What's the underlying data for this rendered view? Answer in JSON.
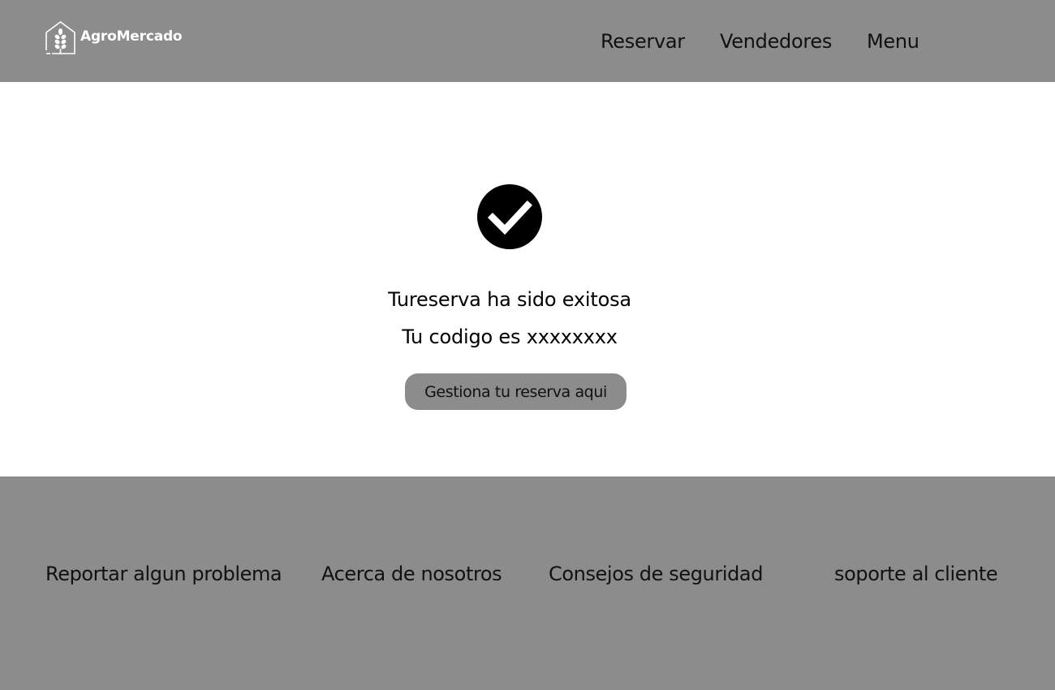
{
  "header": {
    "brand": "AgroMercado",
    "nav": {
      "reservar": "Reservar",
      "vendedores": "Vendedores",
      "menu": "Menu"
    }
  },
  "main": {
    "title": "Tureserva ha sido exitosa",
    "code_text": "Tu codigo es xxxxxxxx",
    "manage_button": "Gestiona tu reserva aqui"
  },
  "footer": {
    "links": [
      "Reportar algun problema",
      "Acerca de nosotros",
      "Consejos de seguridad",
      "soporte al cliente"
    ]
  },
  "icons": {
    "logo": "wheat-house-icon",
    "success": "check-circle-icon"
  },
  "colors": {
    "header_bg": "#8c8c8c",
    "footer_bg": "#8c8c8c",
    "button_bg": "#8c8c8c",
    "page_bg": "#ffffff",
    "logo_text": "#ffffff"
  }
}
